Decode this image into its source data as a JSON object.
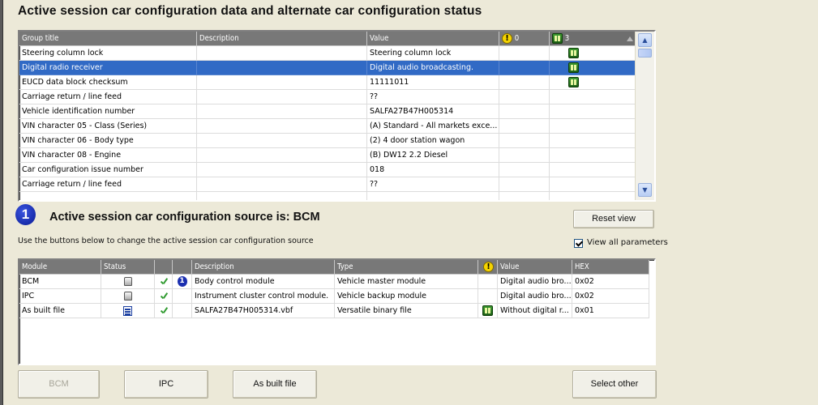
{
  "title": "Active session car configuration data and alternate car configuration status",
  "config_table": {
    "headers": {
      "group_title": "Group title",
      "description": "Description",
      "value": "Value",
      "warn_count": "0",
      "alt_count": "3"
    },
    "rows": [
      {
        "group": "Steering column lock",
        "description": "",
        "value": "Steering column lock",
        "alt": true,
        "selected": false
      },
      {
        "group": "Digital radio receiver",
        "description": "",
        "value": "Digital audio broadcasting.",
        "alt": true,
        "selected": true
      },
      {
        "group": "EUCD data block checksum",
        "description": "",
        "value": "11111011",
        "alt": true,
        "selected": false
      },
      {
        "group": "Carriage return / line feed",
        "description": "",
        "value": "??",
        "alt": false,
        "selected": false
      },
      {
        "group": "Vehicle identification number",
        "description": "",
        "value": "SALFA27B47H005314",
        "alt": false,
        "selected": false
      },
      {
        "group": "VIN character 05 - Class (Series)",
        "description": "",
        "value": "(A) Standard - All markets exce...",
        "alt": false,
        "selected": false
      },
      {
        "group": "VIN character 06 - Body type",
        "description": "",
        "value": "(2) 4 door station wagon",
        "alt": false,
        "selected": false
      },
      {
        "group": "VIN character 08 - Engine",
        "description": "",
        "value": "(B) DW12 2.2 Diesel",
        "alt": false,
        "selected": false
      },
      {
        "group": "Car configuration issue number",
        "description": "",
        "value": "018",
        "alt": false,
        "selected": false
      },
      {
        "group": "Carriage return / line feed",
        "description": "",
        "value": "??",
        "alt": false,
        "selected": false
      }
    ]
  },
  "source_heading": "Active session car configuration source is: BCM",
  "source_badge": "1",
  "reset_view_label": "Reset view",
  "instruction": "Use the buttons below to change the active session car configuration source",
  "view_all_label": "View all parameters",
  "view_all_checked": true,
  "module_table": {
    "headers": {
      "module": "Module",
      "status": "Status",
      "description": "Description",
      "type": "Type",
      "value": "Value",
      "hex": "HEX"
    },
    "rows": [
      {
        "module": "BCM",
        "status_icon": "module-icon",
        "checked": true,
        "active": true,
        "description": "Body control module",
        "type": "Vehicle master module",
        "warn": false,
        "alt": false,
        "value": "Digital audio bro...",
        "hex": "0x02"
      },
      {
        "module": "IPC",
        "status_icon": "module-icon",
        "checked": true,
        "active": false,
        "description": "Instrument cluster control module.",
        "type": "Vehicle backup module",
        "warn": false,
        "alt": false,
        "value": "Digital audio bro...",
        "hex": "0x02"
      },
      {
        "module": "As built file",
        "status_icon": "file-icon",
        "checked": true,
        "active": false,
        "description": "SALFA27B47H005314.vbf",
        "type": "Versatile binary file",
        "warn": false,
        "alt": true,
        "value": "Without digital r...",
        "hex": "0x01"
      }
    ]
  },
  "buttons": {
    "bcm": "BCM",
    "ipc": "IPC",
    "as_built": "As built file",
    "select_other": "Select other"
  },
  "colors": {
    "window_bg": "#ece9d8",
    "header_bg": "#787878",
    "selection": "#316ac5"
  }
}
